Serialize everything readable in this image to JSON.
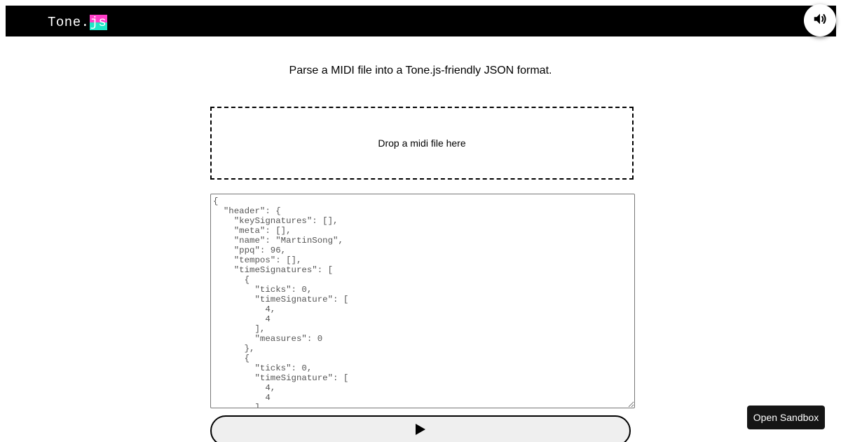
{
  "header": {
    "logo_prefix": "Tone.",
    "logo_suffix": "js",
    "sound_icon": "speaker-volume-icon"
  },
  "main": {
    "description": "Parse a MIDI file into a Tone.js-friendly JSON format.",
    "dropzone_label": "Drop a midi file here",
    "json_output": "{\n  \"header\": {\n    \"keySignatures\": [],\n    \"meta\": [],\n    \"name\": \"MartinSong\",\n    \"ppq\": 96,\n    \"tempos\": [],\n    \"timeSignatures\": [\n      {\n        \"ticks\": 0,\n        \"timeSignature\": [\n          4,\n          4\n        ],\n        \"measures\": 0\n      },\n      {\n        \"ticks\": 0,\n        \"timeSignature\": [\n          4,\n          4\n        ],",
    "play_icon": "play-icon"
  },
  "footer": {
    "sandbox_label": "Open Sandbox"
  },
  "colors": {
    "topbar": "#000000",
    "logo_magenta": "#ff3ec8",
    "logo_cyan": "#1ee6c6",
    "sandbox_bg": "#151515"
  }
}
